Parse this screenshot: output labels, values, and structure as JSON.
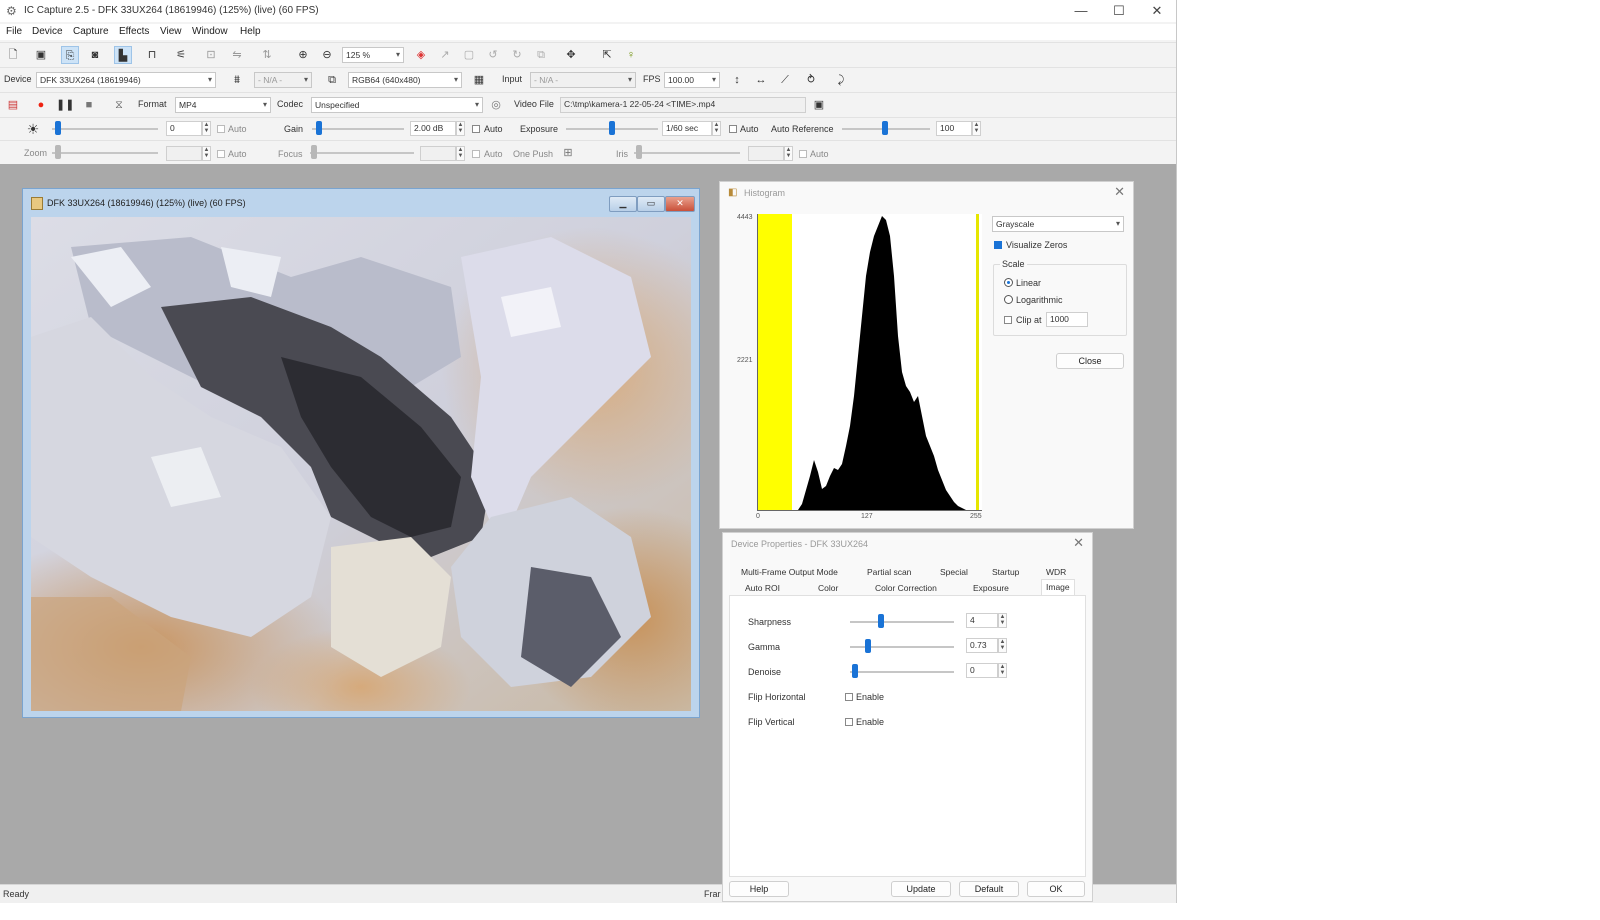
{
  "window": {
    "title": "IC Capture 2.5 - DFK 33UX264 (18619946) (125%) (live) (60 FPS)",
    "minimize": "—",
    "maximize": "☐",
    "close": "✕"
  },
  "menu": [
    "File",
    "Device",
    "Capture",
    "Effects",
    "View",
    "Window",
    "Help"
  ],
  "toolbar1": {
    "zoom_value": "125 %"
  },
  "toolbar2": {
    "device_label": "Device",
    "device_value": "DFK 33UX264 (18619946)",
    "na1": "- N/A -",
    "format_value": "RGB64 (640x480)",
    "input_label": "Input",
    "na2": "- N/A -",
    "fps_label": "FPS",
    "fps_value": "100.00"
  },
  "toolbar3": {
    "format_label": "Format",
    "format_value": "MP4",
    "codec_label": "Codec",
    "codec_value": "Unspecified",
    "videofile_label": "Video File",
    "videofile_value": "C:\\tmp\\kamera-1 22-05-24 <TIME>.mp4"
  },
  "controls1": {
    "brightness_value": "0",
    "auto": "Auto",
    "gain_label": "Gain",
    "gain_value": "2.00 dB",
    "exposure_label": "Exposure",
    "exposure_value": "1/60 sec",
    "auto_reference_label": "Auto Reference",
    "auto_reference_value": "100"
  },
  "controls2": {
    "zoom_label": "Zoom",
    "auto": "Auto",
    "focus_label": "Focus",
    "onepush_label": "One Push",
    "iris_label": "Iris"
  },
  "livewindow": {
    "title": "DFK 33UX264 (18619946) (125%) (live) (60 FPS)"
  },
  "histogram": {
    "title": "Histogram",
    "close": "✕",
    "mode_value": "Grayscale",
    "visualize_zeros": "Visualize Zeros",
    "scale_label": "Scale",
    "linear": "Linear",
    "logarithmic": "Logarithmic",
    "clip_at": "Clip at",
    "clip_value": "1000",
    "close_button": "Close",
    "y_top": "4443",
    "y_mid": "2221",
    "x_left": "0",
    "x_mid": "127",
    "x_right": "255",
    "colors": {
      "yellow": "#ffff00",
      "bars": "#000000"
    }
  },
  "device_properties": {
    "title": "Device Properties - DFK 33UX264",
    "close": "✕",
    "tabs_row1": [
      "Multi-Frame Output Mode",
      "Partial scan",
      "Special",
      "Startup",
      "WDR"
    ],
    "tabs_row2": [
      "Auto ROI",
      "Color",
      "Color Correction",
      "Exposure",
      "Image"
    ],
    "sharpness_label": "Sharpness",
    "sharpness_value": "4",
    "gamma_label": "Gamma",
    "gamma_value": "0.73",
    "denoise_label": "Denoise",
    "denoise_value": "0",
    "flip_h_label": "Flip Horizontal",
    "flip_v_label": "Flip Vertical",
    "enable": "Enable",
    "help": "Help",
    "update": "Update",
    "default": "Default",
    "ok": "OK"
  },
  "status": {
    "left": "Ready",
    "right": "Frar"
  }
}
